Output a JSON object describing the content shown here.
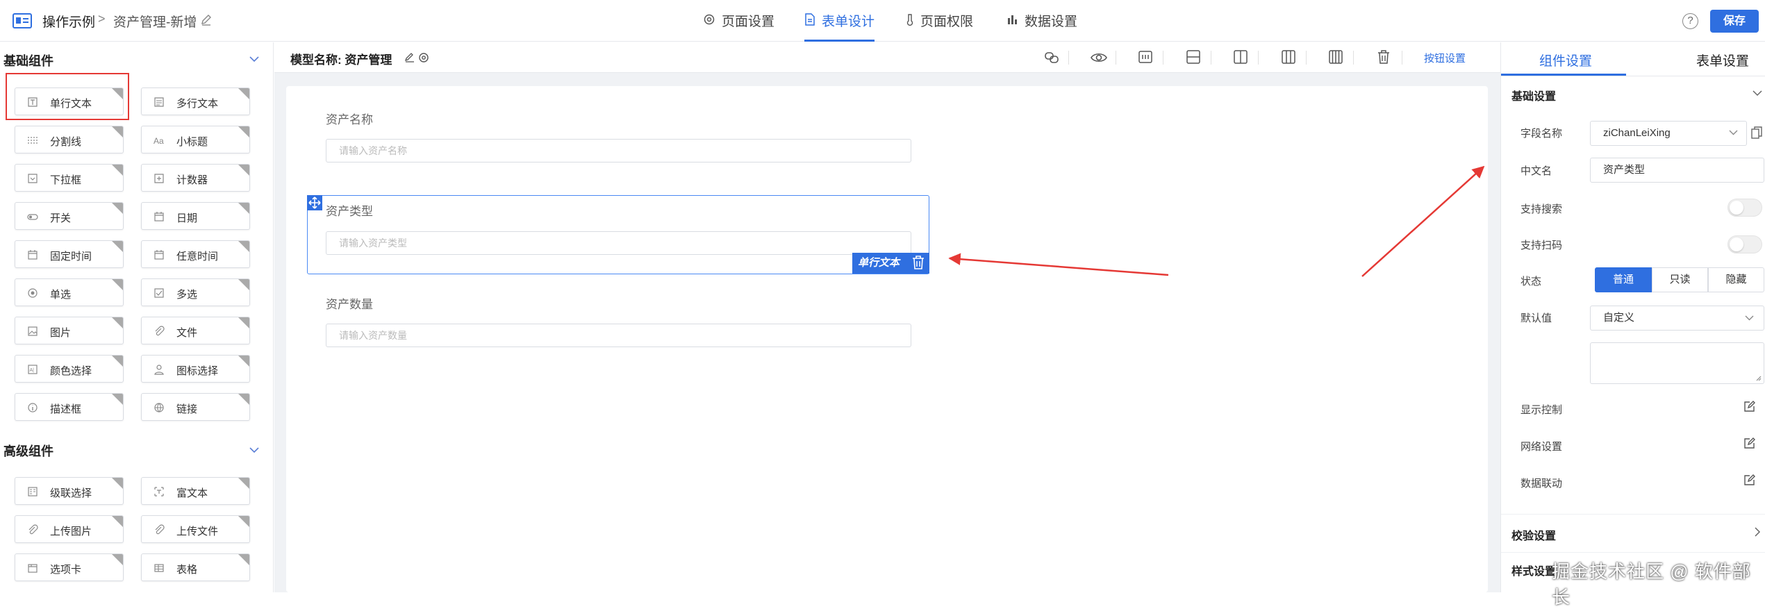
{
  "header": {
    "breadcrumb": [
      "操作示例",
      "资产管理-新增"
    ],
    "breadcrumb_separator": ">",
    "tabs": [
      {
        "label": "页面设置",
        "icon": "gear-icon",
        "active": false
      },
      {
        "label": "表单设计",
        "icon": "document-icon",
        "active": true
      },
      {
        "label": "页面权限",
        "icon": "thermometer-icon",
        "active": false
      },
      {
        "label": "数据设置",
        "icon": "bar-chart-icon",
        "active": false
      }
    ],
    "help_symbol": "?",
    "save_label": "保存"
  },
  "left_panel": {
    "basic_title": "基础组件",
    "basic_components": [
      "单行文本",
      "多行文本",
      "分割线",
      "小标题",
      "下拉框",
      "计数器",
      "开关",
      "日期",
      "固定时间",
      "任意时间",
      "单选",
      "多选",
      "图片",
      "文件",
      "颜色选择",
      "图标选择",
      "描述框",
      "链接"
    ],
    "advanced_title": "高级组件",
    "advanced_components": [
      "级联选择",
      "富文本",
      "上传图片",
      "上传文件",
      "选项卡",
      "表格"
    ]
  },
  "canvas": {
    "model_label": "模型名称: 资产管理",
    "button_settings": "按钮设置",
    "fields": [
      {
        "label": "资产名称",
        "placeholder": "请输入资产名称"
      },
      {
        "label": "资产类型",
        "placeholder": "请输入资产类型"
      },
      {
        "label": "资产数量",
        "placeholder": "请输入资产数量"
      }
    ],
    "selected_badge": "单行文本"
  },
  "right_panel": {
    "tabs": [
      "组件设置",
      "表单设置"
    ],
    "basic_section": "基础设置",
    "field_name_label": "字段名称",
    "field_name_value": "ziChanLeiXing",
    "cn_name_label": "中文名",
    "cn_name_value": "资产类型",
    "search_label": "支持搜索",
    "scan_label": "支持扫码",
    "status_label": "状态",
    "status_options": [
      "普通",
      "只读",
      "隐藏"
    ],
    "status_selected": "普通",
    "default_label": "默认值",
    "default_value": "自定义",
    "display_label": "显示控制",
    "grid_label": "网络设置",
    "linkage_label": "数据联动",
    "validation_section": "校验设置",
    "style_section": "样式设置"
  },
  "watermark": "掘金技术社区 @ 软件部长",
  "colors": {
    "accent": "#2f6fe0",
    "annotation": "#e53935"
  }
}
